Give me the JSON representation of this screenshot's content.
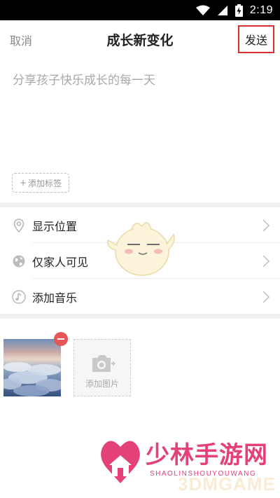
{
  "status_bar": {
    "time": "2:19",
    "icons": [
      "wifi-icon",
      "cellular-icon",
      "battery-charging-icon"
    ]
  },
  "navbar": {
    "cancel_label": "取消",
    "title": "成长新变化",
    "send_label": "发送"
  },
  "editor": {
    "placeholder": "分享孩子快乐成长的每一天",
    "value": ""
  },
  "tag_button": {
    "label": "添加标签"
  },
  "options": [
    {
      "label": "显示位置",
      "icon": "location-pin-icon"
    },
    {
      "label": "仅家人可见",
      "icon": "globe-icon"
    },
    {
      "label": "添加音乐",
      "icon": "music-note-icon"
    }
  ],
  "photos": {
    "add_label": "添加图片",
    "remove_icon": "minus-icon"
  },
  "watermark": {
    "brand": "少林手游网",
    "sub": "SHAOLINSHOUYOUWANG",
    "ghost": "3DMGAME"
  },
  "colors": {
    "highlight": "#d9302f",
    "remove": "#e55656",
    "watermark": "#e4417a"
  }
}
